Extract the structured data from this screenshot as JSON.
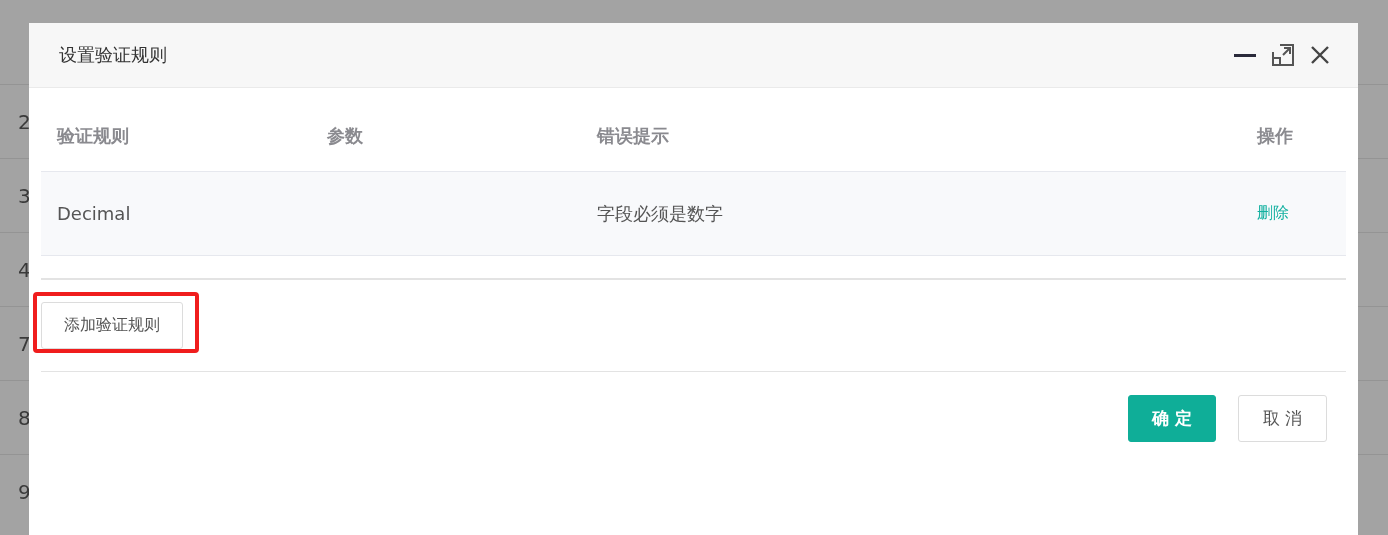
{
  "background_table": {
    "rows": [
      "2",
      "3",
      "4",
      "7",
      "8",
      "9"
    ]
  },
  "dialog": {
    "title": "设置验证规则",
    "table": {
      "columns": [
        "验证规则",
        "参数",
        "错误提示",
        "操作"
      ],
      "rows": [
        {
          "rule": "Decimal",
          "error": "字段必须是数字",
          "action": "删除"
        }
      ]
    },
    "add_button": {
      "label": "添加验证规则",
      "highlighted": true
    },
    "footer_buttons": [
      {
        "label": "确 定",
        "kind": "primary"
      },
      {
        "label": "取 消",
        "kind": "default"
      }
    ]
  }
}
